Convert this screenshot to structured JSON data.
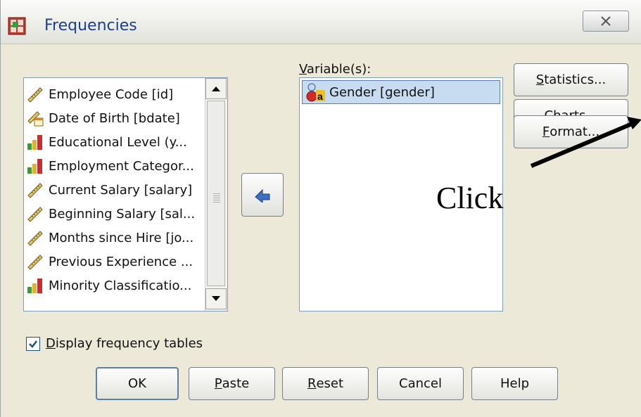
{
  "window": {
    "title": "Frequencies",
    "close_label": "X"
  },
  "source_list": {
    "items": [
      {
        "label": "Employee Code [id]",
        "icon": "ruler-icon"
      },
      {
        "label": "Date of Birth [bdate]",
        "icon": "date-ruler-icon"
      },
      {
        "label": "Educational Level (y...",
        "icon": "bar-chart-icon"
      },
      {
        "label": "Employment Categor...",
        "icon": "bar-chart-icon"
      },
      {
        "label": "Current Salary [salary]",
        "icon": "ruler-icon"
      },
      {
        "label": "Beginning Salary [sal...",
        "icon": "ruler-icon"
      },
      {
        "label": "Months since Hire [jo...",
        "icon": "ruler-icon"
      },
      {
        "label": "Previous Experience ...",
        "icon": "ruler-icon"
      },
      {
        "label": "Minority Classificatio...",
        "icon": "bar-chart-icon"
      }
    ]
  },
  "variables": {
    "label_prefix": "V",
    "label_rest": "ariable(s):",
    "items": [
      {
        "label": "Gender [gender]",
        "icon": "nominal-icon"
      }
    ]
  },
  "side_buttons": {
    "statistics_u": "S",
    "statistics_rest": "tatistics...",
    "charts_u": "C",
    "charts_rest": "harts...",
    "format_u": "F",
    "format_rest": "ormat..."
  },
  "annotation": {
    "text": "Click"
  },
  "checkbox": {
    "u": "D",
    "rest": "isplay frequency tables",
    "checked": true
  },
  "bottom_buttons": {
    "ok": "OK",
    "paste_u": "P",
    "paste_rest": "aste",
    "reset_u": "R",
    "reset_rest": "eset",
    "cancel": "Cancel",
    "help": "Help"
  }
}
